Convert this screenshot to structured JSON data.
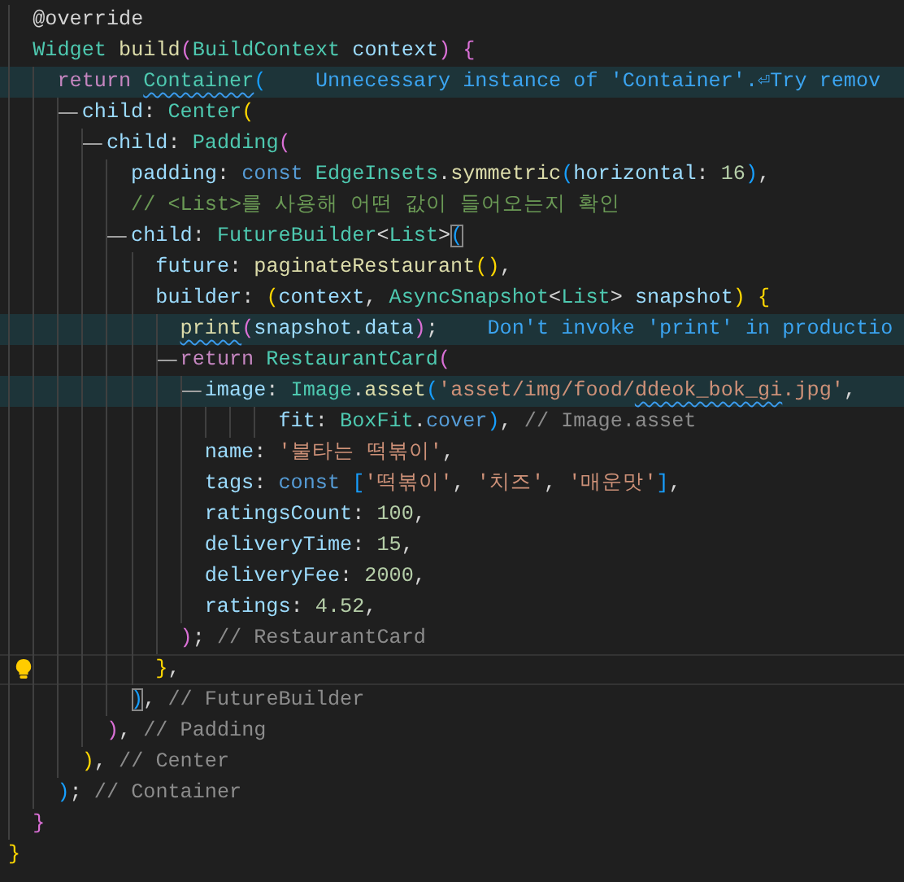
{
  "editor": {
    "lines": [
      {
        "tokens": [
          {
            "t": "  @override",
            "kind": "plain"
          }
        ]
      },
      {
        "tokens": [
          {
            "t": "  Widget",
            "kind": "type"
          },
          {
            "t": " build",
            "kind": "func"
          },
          {
            "t": "(",
            "kind": "b2"
          },
          {
            "t": "BuildContext",
            "kind": "type"
          },
          {
            "t": " context",
            "kind": "prop"
          },
          {
            "t": ")",
            "kind": "b2"
          },
          {
            "t": " {",
            "kind": "b2"
          }
        ]
      },
      {
        "highlighted": true,
        "tokens": [
          {
            "t": "    return ",
            "kind": "keyword"
          },
          {
            "t": "Container",
            "kind": "type",
            "squiggle": true
          },
          {
            "t": "(",
            "kind": "b3"
          }
        ],
        "hint": "Unnecessary instance of 'Container'.⏎Try remov"
      },
      {
        "guide": true,
        "tokens": [
          {
            "t": "      child",
            "kind": "prop"
          },
          {
            "t": ": ",
            "kind": "plain"
          },
          {
            "t": "Center",
            "kind": "type"
          },
          {
            "t": "(",
            "kind": "b1"
          }
        ]
      },
      {
        "guide": true,
        "tokens": [
          {
            "t": "        child",
            "kind": "prop"
          },
          {
            "t": ": ",
            "kind": "plain"
          },
          {
            "t": "Padding",
            "kind": "type"
          },
          {
            "t": "(",
            "kind": "b2"
          }
        ]
      },
      {
        "tokens": [
          {
            "t": "          padding",
            "kind": "prop"
          },
          {
            "t": ": ",
            "kind": "plain"
          },
          {
            "t": "const",
            "kind": "storage"
          },
          {
            "t": " EdgeInsets",
            "kind": "type"
          },
          {
            "t": ".",
            "kind": "plain"
          },
          {
            "t": "symmetric",
            "kind": "func"
          },
          {
            "t": "(",
            "kind": "b3"
          },
          {
            "t": "horizontal",
            "kind": "prop"
          },
          {
            "t": ": ",
            "kind": "plain"
          },
          {
            "t": "16",
            "kind": "number"
          },
          {
            "t": ")",
            "kind": "b3"
          },
          {
            "t": ",",
            "kind": "plain"
          }
        ]
      },
      {
        "tokens": [
          {
            "t": "          // <List>를 사용해 어떤 값이 들어오는지 확인",
            "kind": "comment"
          }
        ]
      },
      {
        "guide": true,
        "tokens": [
          {
            "t": "          child",
            "kind": "prop"
          },
          {
            "t": ": ",
            "kind": "plain"
          },
          {
            "t": "FutureBuilder",
            "kind": "type"
          },
          {
            "t": "<",
            "kind": "plain"
          },
          {
            "t": "List",
            "kind": "type"
          },
          {
            "t": ">",
            "kind": "plain"
          },
          {
            "t": "(",
            "kind": "b3",
            "match": true
          }
        ]
      },
      {
        "tokens": [
          {
            "t": "            future",
            "kind": "prop"
          },
          {
            "t": ": ",
            "kind": "plain"
          },
          {
            "t": "paginateRestaurant",
            "kind": "func"
          },
          {
            "t": "()",
            "kind": "b1"
          },
          {
            "t": ",",
            "kind": "plain"
          }
        ]
      },
      {
        "tokens": [
          {
            "t": "            builder",
            "kind": "prop"
          },
          {
            "t": ": ",
            "kind": "plain"
          },
          {
            "t": "(",
            "kind": "b1"
          },
          {
            "t": "context",
            "kind": "prop"
          },
          {
            "t": ", ",
            "kind": "plain"
          },
          {
            "t": "AsyncSnapshot",
            "kind": "type"
          },
          {
            "t": "<",
            "kind": "plain"
          },
          {
            "t": "List",
            "kind": "type"
          },
          {
            "t": "> ",
            "kind": "plain"
          },
          {
            "t": "snapshot",
            "kind": "prop"
          },
          {
            "t": ")",
            "kind": "b1"
          },
          {
            "t": " {",
            "kind": "b1"
          }
        ]
      },
      {
        "highlighted": true,
        "tokens": [
          {
            "t": "              print",
            "kind": "func",
            "squiggle": true
          },
          {
            "t": "(",
            "kind": "b2"
          },
          {
            "t": "snapshot",
            "kind": "prop"
          },
          {
            "t": ".",
            "kind": "plain"
          },
          {
            "t": "data",
            "kind": "prop"
          },
          {
            "t": ")",
            "kind": "b2"
          },
          {
            "t": ";",
            "kind": "plain"
          }
        ],
        "hint": "Don't invoke 'print' in productio"
      },
      {
        "guide": true,
        "tokens": [
          {
            "t": "              return ",
            "kind": "keyword"
          },
          {
            "t": "RestaurantCard",
            "kind": "type"
          },
          {
            "t": "(",
            "kind": "b2"
          }
        ]
      },
      {
        "guide": true,
        "highlighted": true,
        "tokens": [
          {
            "t": "                image",
            "kind": "prop"
          },
          {
            "t": ": ",
            "kind": "plain"
          },
          {
            "t": "Image",
            "kind": "type"
          },
          {
            "t": ".",
            "kind": "plain"
          },
          {
            "t": "asset",
            "kind": "func"
          },
          {
            "t": "(",
            "kind": "b3"
          },
          {
            "t": "'asset/img/food/",
            "kind": "string"
          },
          {
            "t": "ddeok_bok_gi",
            "kind": "string",
            "squiggle": true
          },
          {
            "t": ".jpg'",
            "kind": "string"
          },
          {
            "t": ",",
            "kind": "plain"
          }
        ]
      },
      {
        "tokens": [
          {
            "t": "                      fit",
            "kind": "prop"
          },
          {
            "t": ": ",
            "kind": "plain"
          },
          {
            "t": "BoxFit",
            "kind": "type"
          },
          {
            "t": ".",
            "kind": "plain"
          },
          {
            "t": "cover",
            "kind": "storage"
          },
          {
            "t": ")",
            "kind": "b3"
          },
          {
            "t": ", ",
            "kind": "plain"
          },
          {
            "t": "// Image.asset",
            "kind": "label"
          }
        ]
      },
      {
        "tokens": [
          {
            "t": "                name",
            "kind": "prop"
          },
          {
            "t": ": ",
            "kind": "plain"
          },
          {
            "t": "'불타는 떡볶이'",
            "kind": "string"
          },
          {
            "t": ",",
            "kind": "plain"
          }
        ]
      },
      {
        "tokens": [
          {
            "t": "                tags",
            "kind": "prop"
          },
          {
            "t": ": ",
            "kind": "plain"
          },
          {
            "t": "const ",
            "kind": "storage"
          },
          {
            "t": "[",
            "kind": "b3"
          },
          {
            "t": "'떡볶이'",
            "kind": "string"
          },
          {
            "t": ", ",
            "kind": "plain"
          },
          {
            "t": "'치즈'",
            "kind": "string"
          },
          {
            "t": ", ",
            "kind": "plain"
          },
          {
            "t": "'매운맛'",
            "kind": "string"
          },
          {
            "t": "]",
            "kind": "b3"
          },
          {
            "t": ",",
            "kind": "plain"
          }
        ]
      },
      {
        "tokens": [
          {
            "t": "                ratingsCount",
            "kind": "prop"
          },
          {
            "t": ": ",
            "kind": "plain"
          },
          {
            "t": "100",
            "kind": "number"
          },
          {
            "t": ",",
            "kind": "plain"
          }
        ]
      },
      {
        "tokens": [
          {
            "t": "                deliveryTime",
            "kind": "prop"
          },
          {
            "t": ": ",
            "kind": "plain"
          },
          {
            "t": "15",
            "kind": "number"
          },
          {
            "t": ",",
            "kind": "plain"
          }
        ]
      },
      {
        "tokens": [
          {
            "t": "                deliveryFee",
            "kind": "prop"
          },
          {
            "t": ": ",
            "kind": "plain"
          },
          {
            "t": "2000",
            "kind": "number"
          },
          {
            "t": ",",
            "kind": "plain"
          }
        ]
      },
      {
        "tokens": [
          {
            "t": "                ratings",
            "kind": "prop"
          },
          {
            "t": ": ",
            "kind": "plain"
          },
          {
            "t": "4.52",
            "kind": "number"
          },
          {
            "t": ",",
            "kind": "plain"
          }
        ]
      },
      {
        "tokens": [
          {
            "t": "              )",
            "kind": "b2"
          },
          {
            "t": "; ",
            "kind": "plain"
          },
          {
            "t": "// RestaurantCard",
            "kind": "label"
          }
        ]
      },
      {
        "current": true,
        "lightbulb": true,
        "tokens": [
          {
            "t": "            }",
            "kind": "b1"
          },
          {
            "t": ",",
            "kind": "plain"
          }
        ]
      },
      {
        "tokens": [
          {
            "t": "          )",
            "kind": "b3",
            "match": true
          },
          {
            "t": ", ",
            "kind": "plain"
          },
          {
            "t": "// FutureBuilder",
            "kind": "label"
          }
        ]
      },
      {
        "tokens": [
          {
            "t": "        )",
            "kind": "b2"
          },
          {
            "t": ", ",
            "kind": "plain"
          },
          {
            "t": "// Padding",
            "kind": "label"
          }
        ]
      },
      {
        "tokens": [
          {
            "t": "      )",
            "kind": "b1"
          },
          {
            "t": ", ",
            "kind": "plain"
          },
          {
            "t": "// Center",
            "kind": "label"
          }
        ]
      },
      {
        "tokens": [
          {
            "t": "    )",
            "kind": "b3"
          },
          {
            "t": "; ",
            "kind": "plain"
          },
          {
            "t": "// Container",
            "kind": "label"
          }
        ]
      },
      {
        "tokens": [
          {
            "t": "  }",
            "kind": "b2"
          }
        ]
      },
      {
        "tokens": [
          {
            "t": "}",
            "kind": "b1"
          }
        ]
      }
    ]
  }
}
